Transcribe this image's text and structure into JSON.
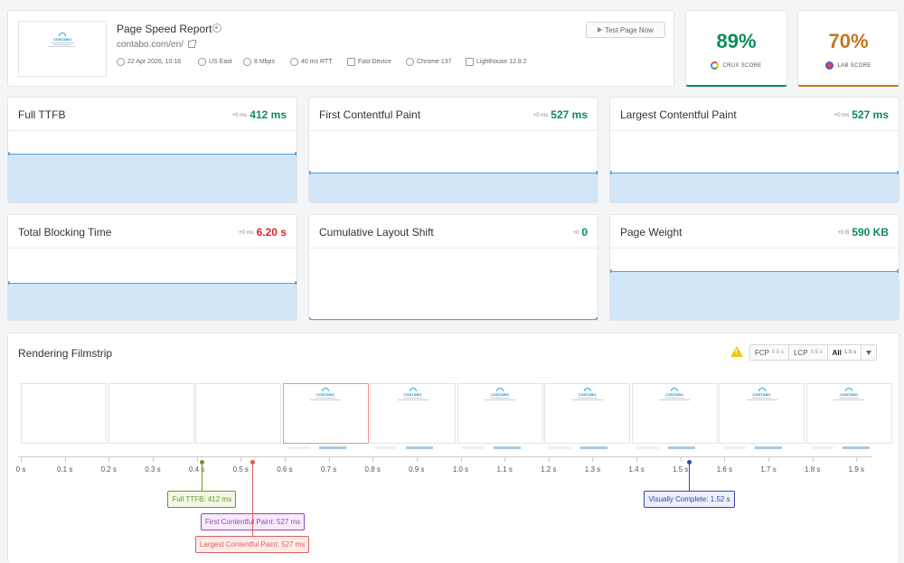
{
  "header": {
    "title": "Page Speed Report",
    "url": "contabo.com/en/",
    "test_button": "Test Page Now",
    "meta": [
      {
        "icon": "clock-icon",
        "text": "22 Apr 2026, 10:16"
      },
      {
        "icon": "globe-icon",
        "text": "US East"
      },
      {
        "icon": "connection-icon",
        "text": "8 Mbps"
      },
      {
        "icon": "latency-icon",
        "text": "40 ms RTT"
      },
      {
        "icon": "device-icon",
        "text": "Fast Device"
      },
      {
        "icon": "chrome-icon",
        "text": "Chrome 137"
      },
      {
        "icon": "lighthouse-icon",
        "text": "Lighthouse 12.8.2"
      }
    ],
    "thumb_logo": "CONTABO"
  },
  "scores": {
    "crux": {
      "value": "89%",
      "label": "CRUX SCORE",
      "color": "#0b8d57"
    },
    "lab": {
      "value": "70%",
      "label": "LAB SCORE",
      "color": "#c8751a"
    }
  },
  "metrics": [
    {
      "name": "Full TTFB",
      "delta": "+0 ms",
      "value": "412 ms",
      "status": "good"
    },
    {
      "name": "First Contentful Paint",
      "delta": "+0 ms",
      "value": "527 ms",
      "status": "good"
    },
    {
      "name": "Largest Contentful Paint",
      "delta": "+0 ms",
      "value": "527 ms",
      "status": "good"
    },
    {
      "name": "Total Blocking Time",
      "delta": "+0 ms",
      "value": "6.20 s",
      "status": "poor"
    },
    {
      "name": "Cumulative Layout Shift",
      "delta": "+0",
      "value": "0",
      "status": "good"
    },
    {
      "name": "Page Weight",
      "delta": "+0 B",
      "value": "590 KB",
      "status": "good"
    }
  ],
  "filmstrip": {
    "title": "Rendering Filmstrip",
    "ranges": [
      {
        "label": "FCP",
        "sub": "0.5 s"
      },
      {
        "label": "LCP",
        "sub": "0.5 s"
      },
      {
        "label": "All",
        "sub": "1.5 s",
        "active": true
      }
    ],
    "ticks": [
      "0 s",
      "0.1 s",
      "0.2 s",
      "0.3 s",
      "0.4 s",
      "0.5 s",
      "0.6 s",
      "0.7 s",
      "0.8 s",
      "0.9 s",
      "1.0 s",
      "1.1 s",
      "1.2 s",
      "1.3 s",
      "1.4 s",
      "1.5 s",
      "1.6 s",
      "1.7 s",
      "1.8 s",
      "1.9 s"
    ],
    "frames": [
      {
        "time": 0,
        "content": false
      },
      {
        "time": 0.2,
        "content": false
      },
      {
        "time": 0.4,
        "content": false
      },
      {
        "time": 0.6,
        "content": true,
        "highlight": true
      },
      {
        "time": 0.8,
        "content": true
      },
      {
        "time": 1.0,
        "content": true
      },
      {
        "time": 1.2,
        "content": true
      },
      {
        "time": 1.4,
        "content": true
      },
      {
        "time": 1.6,
        "content": true
      },
      {
        "time": 1.8,
        "content": true
      }
    ],
    "markers": [
      {
        "label": "Full TTFB: 412 ms",
        "time": 0.412,
        "color": "#6a9a2a",
        "bg": "#f1f8e6",
        "row": 0
      },
      {
        "label": "First Contentful Paint: 527 ms",
        "time": 0.527,
        "color": "#9b45b8",
        "bg": "#f7ebfb",
        "row": 1
      },
      {
        "label": "Largest Contentful Paint: 527 ms",
        "time": 0.527,
        "color": "#e0605a",
        "bg": "#fdeceb",
        "row": 2
      },
      {
        "label": "Visually Complete: 1.52 s",
        "time": 1.52,
        "color": "#3a47a8",
        "bg": "#eceefa",
        "row": 0
      }
    ]
  }
}
